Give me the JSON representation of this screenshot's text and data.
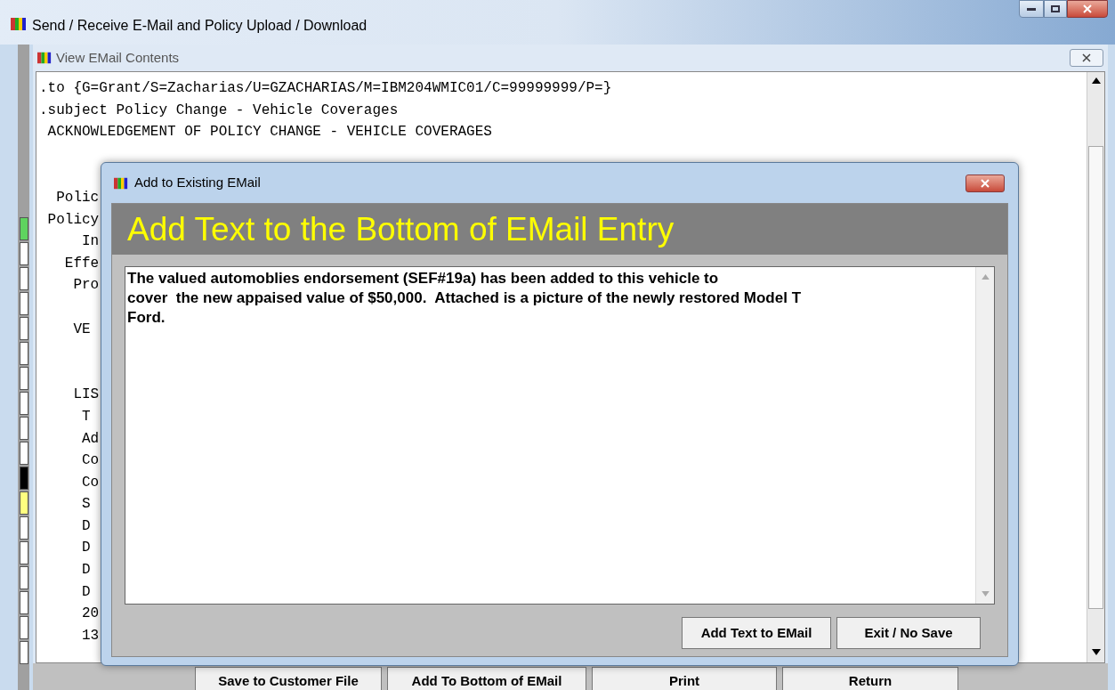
{
  "window": {
    "title": "Send / Receive E-Mail and Policy Upload / Download"
  },
  "side_markers": [
    {
      "color": "#5fd35f"
    },
    {
      "color": "#ffffff"
    },
    {
      "color": "#ffffff"
    },
    {
      "color": "#ffffff"
    },
    {
      "color": "#ffffff"
    },
    {
      "color": "#ffffff"
    },
    {
      "color": "#ffffff"
    },
    {
      "color": "#ffffff"
    },
    {
      "color": "#ffffff"
    },
    {
      "color": "#ffffff"
    },
    {
      "color": "#000000"
    },
    {
      "color": "#ffff80"
    },
    {
      "color": "#ffffff"
    },
    {
      "color": "#ffffff"
    },
    {
      "color": "#ffffff"
    },
    {
      "color": "#ffffff"
    },
    {
      "color": "#ffffff"
    },
    {
      "color": "#ffffff"
    }
  ],
  "email_window": {
    "title": "View EMail Contents",
    "lines": [
      {
        "kind": "text",
        "text": ".to {G=Grant/S=Zacharias/U=GZACHARIAS/M=IBM204WMIC01/C=99999999/P=}"
      },
      {
        "kind": "text",
        "text": ".subject Policy Change - Vehicle Coverages"
      },
      {
        "kind": "text",
        "text": " ACKNOWLEDGEMENT OF POLICY CHANGE - VEHICLE COVERAGES"
      },
      {
        "kind": "blank"
      },
      {
        "kind": "blank"
      },
      {
        "kind": "text",
        "text": "  Polic"
      },
      {
        "kind": "text",
        "text": " Policy"
      },
      {
        "kind": "text",
        "text": "     In"
      },
      {
        "kind": "text",
        "text": "   Effe"
      },
      {
        "kind": "text",
        "text": "    Pro"
      },
      {
        "kind": "blank"
      },
      {
        "kind": "text",
        "text": "    VE"
      },
      {
        "kind": "blank"
      },
      {
        "kind": "blank"
      },
      {
        "kind": "text",
        "text": "    LIS"
      },
      {
        "kind": "text",
        "text": "     T"
      },
      {
        "kind": "text",
        "text": "     Ad"
      },
      {
        "kind": "text",
        "text": "     Co"
      },
      {
        "kind": "text",
        "text": "     Co"
      },
      {
        "kind": "text",
        "text": "     S"
      },
      {
        "kind": "text",
        "text": "     D"
      },
      {
        "kind": "text",
        "text": "     D"
      },
      {
        "kind": "text",
        "text": "     D"
      },
      {
        "kind": "text",
        "text": "     D"
      },
      {
        "kind": "text",
        "text": "     20"
      },
      {
        "kind": "text",
        "text": "     13"
      }
    ],
    "buttons": [
      "Save to Customer File",
      "Add To Bottom of EMail",
      "Print",
      "Return"
    ]
  },
  "dialog": {
    "title": "Add to Existing EMail",
    "heading": "Add Text to the Bottom of EMail Entry",
    "value": "The valued automoblies endorsement (SEF#19a) has been added to this vehicle to\ncover  the new appaised value of $50,000.  Attached is a picture of the newly restored Model T\nFord.",
    "buttons": [
      "Add Text to EMail",
      "Exit / No Save"
    ]
  }
}
